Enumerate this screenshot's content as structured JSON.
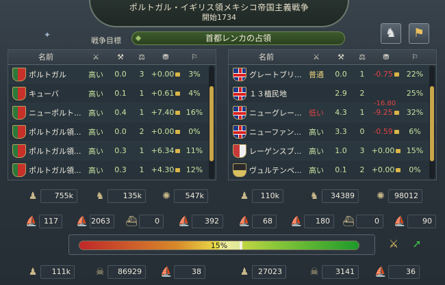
{
  "title": "ポルトガル・イギリス領メキシコ帝国主義戦争",
  "subtitle": "開始1734",
  "goal": {
    "label": "戦争目標",
    "value": "首都レンカの占領"
  },
  "columns": [
    "名前",
    "⚔",
    "⚒",
    "⚖",
    "⛃",
    "⚐"
  ],
  "attackers": [
    {
      "name": "ポルトガル",
      "status": "高い",
      "v1": "0.0",
      "v2": "3",
      "v3": "+0.00",
      "pct": "3%",
      "flag": "pt"
    },
    {
      "name": "キューバ",
      "status": "高い",
      "v1": "0.1",
      "v2": "1",
      "v3": "+0.61",
      "pct": "4%",
      "flag": "pt"
    },
    {
      "name": "ニューポルト...",
      "status": "高い",
      "v1": "0.4",
      "v2": "1",
      "v3": "+7.40",
      "pct": "16%",
      "flag": "pt"
    },
    {
      "name": "ポルトガル領...",
      "status": "高い",
      "v1": "0.0",
      "v2": "2",
      "v3": "+0.00",
      "pct": "0%",
      "flag": "pt"
    },
    {
      "name": "ポルトガル領...",
      "status": "高い",
      "v1": "0.3",
      "v2": "1",
      "v3": "+6.34",
      "pct": "11%",
      "flag": "pt"
    },
    {
      "name": "ポルトガル領...",
      "status": "高い",
      "v1": "0.3",
      "v2": "1",
      "v3": "+4.30",
      "pct": "12%",
      "flag": "pt"
    }
  ],
  "defenders": [
    {
      "name": "グレートブリ...",
      "status": "普通",
      "v1": "0.0",
      "v2": "1",
      "v3": "-0.75",
      "pct": "22%",
      "flag": "gb",
      "status_class": "mid",
      "v3_class": "neg"
    },
    {
      "name": "１３植民地",
      "status": "",
      "v1": "2.9",
      "v2": "2",
      "v3": "",
      "pct": "25%",
      "flag": "gb",
      "status_class": "",
      "v3_class": ""
    },
    {
      "name": "ニューグレー...",
      "status": "低い",
      "v1": "4.3",
      "v2": "1",
      "v3": "-9.25",
      "extra": "-16.80",
      "pct": "32%",
      "flag": "gb",
      "status_class": "low",
      "v3_class": "neg"
    },
    {
      "name": "ニューファン...",
      "status": "高い",
      "v1": "3.3",
      "v2": "0",
      "v3": "-0.59",
      "pct": "6%",
      "flag": "gb",
      "status_class": "",
      "v3_class": "neg"
    },
    {
      "name": "レーゲンスブ...",
      "status": "高い",
      "v1": "1.0",
      "v2": "3",
      "v3": "+0.00",
      "pct": "15%",
      "flag": "pale",
      "status_class": "",
      "v3_class": ""
    },
    {
      "name": "ヴュルテンベ...",
      "status": "高い",
      "v1": "0.1",
      "v2": "2",
      "v3": "+0.00",
      "pct": "0%",
      "flag": "black",
      "status_class": "",
      "v3_class": ""
    }
  ],
  "left_army": {
    "infantry": "755k",
    "cavalry": "135k",
    "artillery": "547k"
  },
  "left_navy": {
    "heavy": "117",
    "light": "2063",
    "galley": "0",
    "transport": "392"
  },
  "right_army": {
    "infantry": "110k",
    "cavalry": "34389",
    "artillery": "98012"
  },
  "right_navy": {
    "heavy": "68",
    "light": "180",
    "galley": "0",
    "transport": "90"
  },
  "warscore": {
    "label": "15%",
    "value": 15
  },
  "left_losses": {
    "infantry": "111k",
    "cavalry": "86929",
    "ships": "38"
  },
  "right_losses": {
    "infantry": "27023",
    "cavalry": "3141",
    "ships": "36"
  },
  "colors": {
    "positive": "#c8e4a0",
    "negative": "#e04444",
    "gold": "#d9b648"
  },
  "chart_data": {
    "type": "bar",
    "title": "",
    "categories": [
      "15%"
    ],
    "values": [
      15
    ],
    "ylim": [
      -100,
      100
    ]
  }
}
